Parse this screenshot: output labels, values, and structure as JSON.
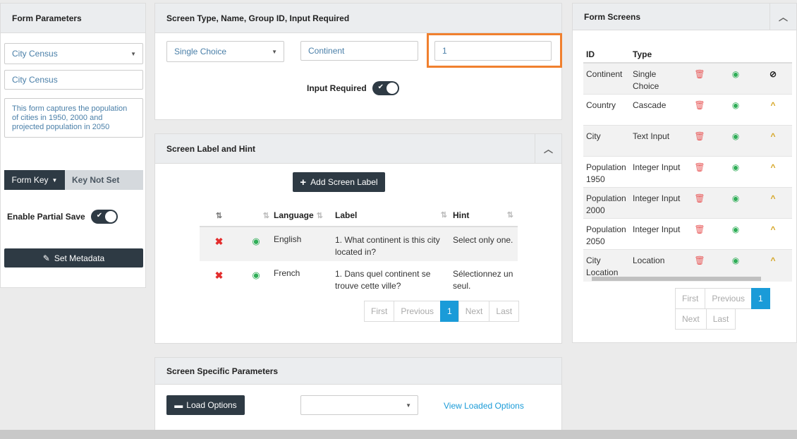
{
  "form_parameters": {
    "title": "Form Parameters",
    "form_select": "City Census",
    "form_name": "City Census",
    "description": "This form captures the population of cities in 1950, 2000 and projected population in 2050",
    "form_key_label": "Form Key",
    "key_status": "Key Not Set",
    "partial_save_label": "Enable Partial Save",
    "metadata_button": "Set Metadata"
  },
  "screen_type": {
    "title": "Screen Type, Name, Group ID, Input Required",
    "type_select": "Single Choice",
    "name_value": "Continent",
    "group_id_value": "1",
    "input_required_label": "Input Required"
  },
  "screen_label": {
    "title": "Screen Label and Hint",
    "add_button": "Add Screen Label",
    "columns": [
      "Language",
      "Label",
      "Hint"
    ],
    "rows": [
      {
        "language": "English",
        "label": "1. What continent is this city located in?",
        "hint": "Select only one."
      },
      {
        "language": "French",
        "label": "1. Dans quel continent se trouve cette ville?",
        "hint": "Sélectionnez un seul."
      }
    ],
    "pager": {
      "first": "First",
      "previous": "Previous",
      "page": "1",
      "next": "Next",
      "last": "Last"
    }
  },
  "screen_params": {
    "title": "Screen Specific Parameters",
    "load_button": "Load Options",
    "options_select": "",
    "view_link": "View Loaded Options"
  },
  "form_screens": {
    "title": "Form Screens",
    "columns": [
      "ID",
      "Type"
    ],
    "rows": [
      {
        "id": "Continent",
        "type": "Single Choice",
        "last_icon": "ban-icon"
      },
      {
        "id": "Country",
        "type": "Cascade",
        "last_icon": "chevron-up-icon"
      },
      {
        "id": "City",
        "type": "Text Input",
        "last_icon": "chevron-up-icon"
      },
      {
        "id": "Population 1950",
        "type": "Integer Input",
        "last_icon": "chevron-up-icon"
      },
      {
        "id": "Population 2000",
        "type": "Integer Input",
        "last_icon": "chevron-up-icon"
      },
      {
        "id": "Population 2050",
        "type": "Integer Input",
        "last_icon": "chevron-up-icon"
      },
      {
        "id": "City Location",
        "type": "Location",
        "last_icon": "chevron-up-icon"
      }
    ],
    "pager": {
      "first": "First",
      "previous": "Previous",
      "page": "1",
      "next": "Next",
      "last": "Last"
    }
  },
  "colors": {
    "highlight": "#f0802e",
    "dark": "#2e3a44",
    "accent": "#1a9bd8"
  }
}
